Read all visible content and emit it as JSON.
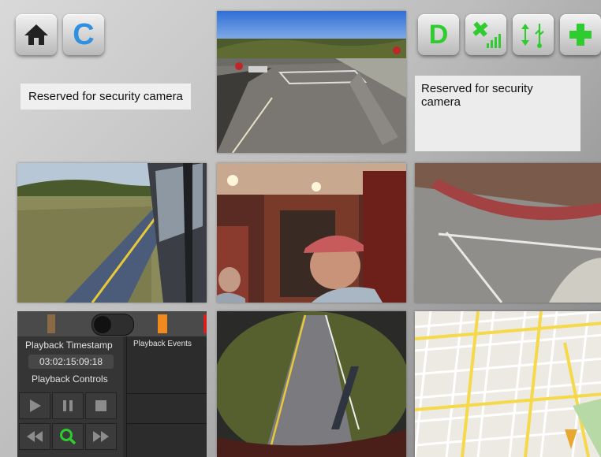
{
  "nav_buttons": {
    "home_icon": "home-icon",
    "c_label": "C"
  },
  "reserved_left": "Reserved for security camera",
  "reserved_right": "Reserved for security camera",
  "status_buttons": {
    "d_label": "D",
    "satellite_icon": "satellite-signal-icon",
    "usb_icon": "usb-transfer-icon",
    "add_icon": "plus-icon"
  },
  "cameras": [
    {
      "id": "cam-front-road"
    },
    {
      "id": "cam-left-side"
    },
    {
      "id": "cam-cab-interior"
    },
    {
      "id": "cam-right-side"
    },
    {
      "id": "cam-rear-road"
    },
    {
      "id": "map-view"
    }
  ],
  "playback": {
    "timestamp_label": "Playback Timestamp",
    "timestamp_value": "03:02:15:09:18",
    "controls_label": "Playback Controls",
    "events_label": "Playback Events"
  },
  "colors": {
    "accent_green": "#2ecc2e",
    "accent_blue": "#2f8fe0",
    "timeline_orange": "#f08a1e",
    "timeline_red": "#d62020"
  }
}
